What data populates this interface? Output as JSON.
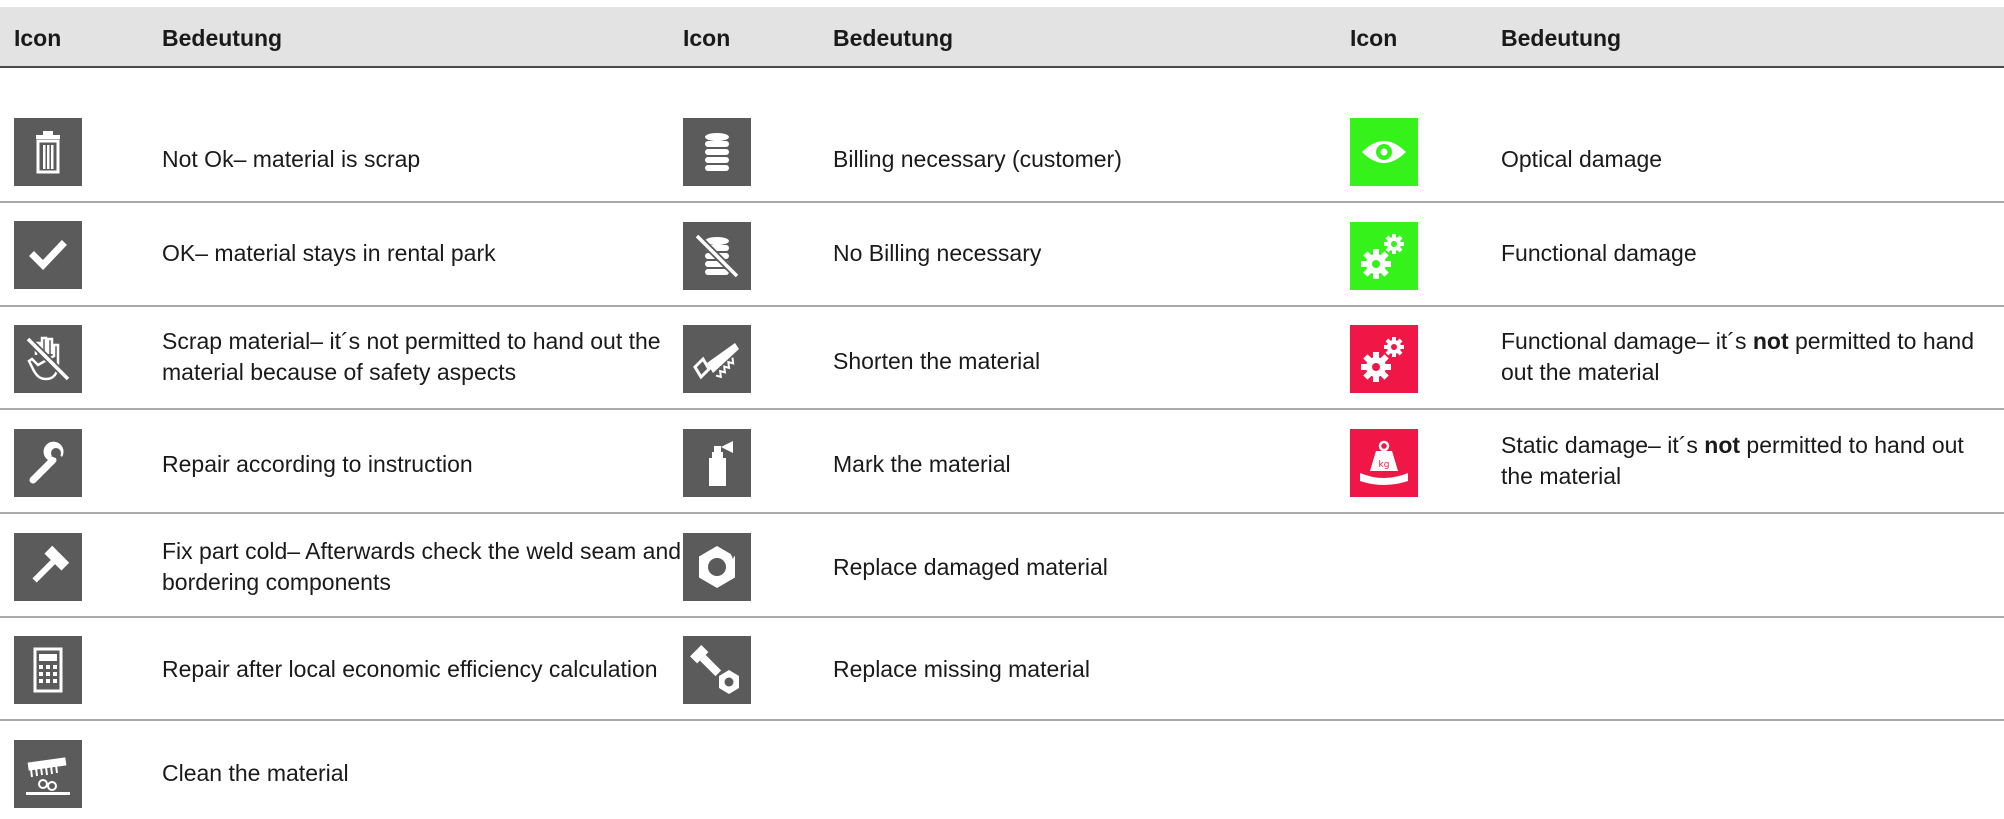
{
  "header": {
    "col1_icon": "Icon",
    "col1_meaning": "Bedeutung",
    "col2_icon": "Icon",
    "col2_meaning": "Bedeutung",
    "col3_icon": "Icon",
    "col3_meaning": "Bedeutung"
  },
  "colors": {
    "icon_gray": "#5b5b5b",
    "icon_green": "#35f21b",
    "icon_red": "#f01746",
    "header_bg": "#e3e3e3"
  },
  "col1": [
    {
      "icon": "trash-icon",
      "text": "Not Ok– material is scrap"
    },
    {
      "icon": "check-icon",
      "text": "OK– material stays in rental park"
    },
    {
      "icon": "no-hand-icon",
      "text": "Scrap material– it´s not permitted to hand out the material because of safety aspects"
    },
    {
      "icon": "wrench-icon",
      "text": "Repair according to instruction"
    },
    {
      "icon": "hammer-icon",
      "text": "Fix part cold– Afterwards check the weld seam and bordering components"
    },
    {
      "icon": "calculator-icon",
      "text": "Repair after local economic efficiency calculation"
    },
    {
      "icon": "brush-icon",
      "text": "Clean the material"
    }
  ],
  "col2": [
    {
      "icon": "coins-icon",
      "text": "Billing necessary (customer)"
    },
    {
      "icon": "no-coins-icon",
      "text": "No Billing necessary"
    },
    {
      "icon": "saw-icon",
      "text": "Shorten the material"
    },
    {
      "icon": "spray-can-icon",
      "text": "Mark the material"
    },
    {
      "icon": "nut-icon",
      "text": "Replace damaged material"
    },
    {
      "icon": "bolt-nut-icon",
      "text": "Replace missing material"
    }
  ],
  "col3": [
    {
      "icon": "eye-icon",
      "text": "Optical damage"
    },
    {
      "icon": "gears-green-icon",
      "text": "Functional damage"
    },
    {
      "icon": "gears-red-icon",
      "text_a": "Functional damage– it´s ",
      "text_b": "not",
      "text_c": " permitted to hand out the material"
    },
    {
      "icon": "weight-red-icon",
      "text_a": "Static damage– it´s ",
      "text_b": "not",
      "text_c": " permitted to hand out the material"
    }
  ]
}
